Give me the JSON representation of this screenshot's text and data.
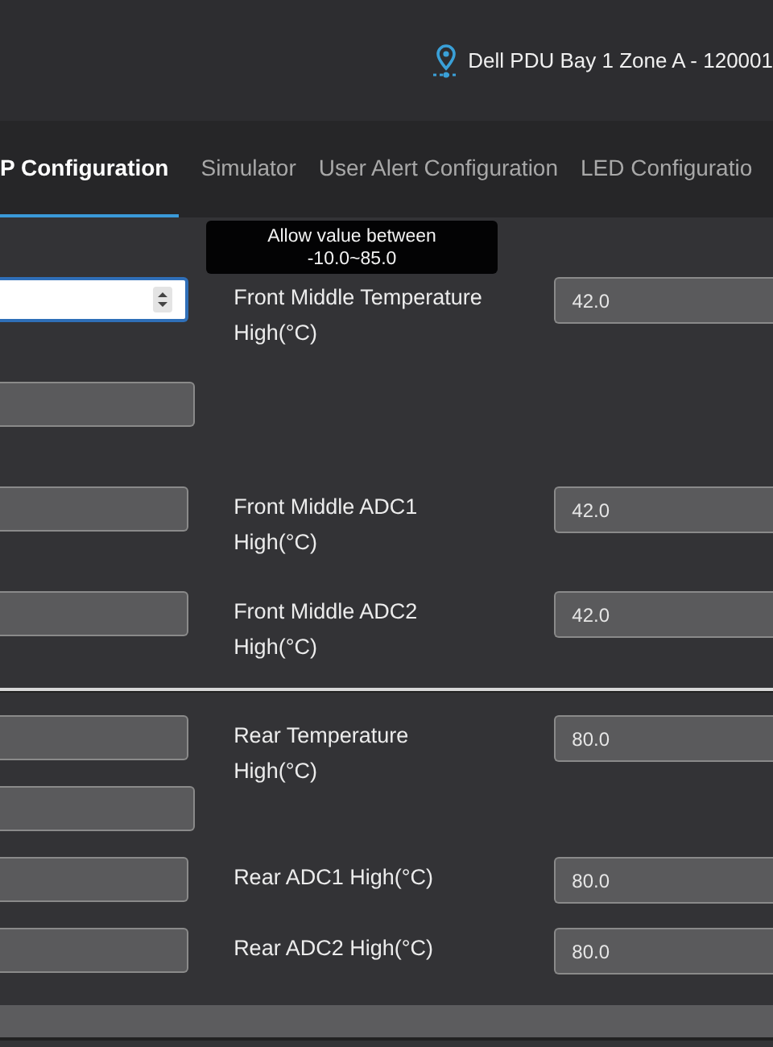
{
  "header": {
    "location": "Dell PDU Bay 1 Zone A - 120001"
  },
  "tabs": [
    {
      "label": "P Configuration",
      "selected": true
    },
    {
      "label": "Simulator",
      "selected": false
    },
    {
      "label": "User Alert Configuration",
      "selected": false
    },
    {
      "label": "LED Configuratio",
      "selected": false
    }
  ],
  "sections": [
    {
      "rows": [
        {
          "left": {
            "focused": true
          },
          "label": "Front Middle Temperature High(°C)",
          "value": "42.0"
        },
        {
          "left": {
            "focused": false
          }
        },
        {
          "left": {
            "focused": false
          },
          "label": "Front Middle ADC1 High(°C)",
          "value": "42.0"
        },
        {
          "left": {
            "focused": false
          },
          "label": "Front Middle ADC2 High(°C)",
          "value": "42.0"
        }
      ]
    },
    {
      "rows": [
        {
          "left": {
            "focused": false
          },
          "label": "Rear Temperature High(°C)",
          "value": "80.0"
        },
        {
          "left": {
            "focused": false
          }
        },
        {
          "left": {
            "focused": false
          },
          "label": "Rear ADC1 High(°C)",
          "value": "80.0"
        },
        {
          "left": {
            "focused": false
          },
          "label": "Rear ADC2 High(°C)",
          "value": "80.0"
        }
      ]
    }
  ],
  "tooltip": {
    "lines": [
      "Allow value between",
      "-10.0~85.0"
    ]
  }
}
